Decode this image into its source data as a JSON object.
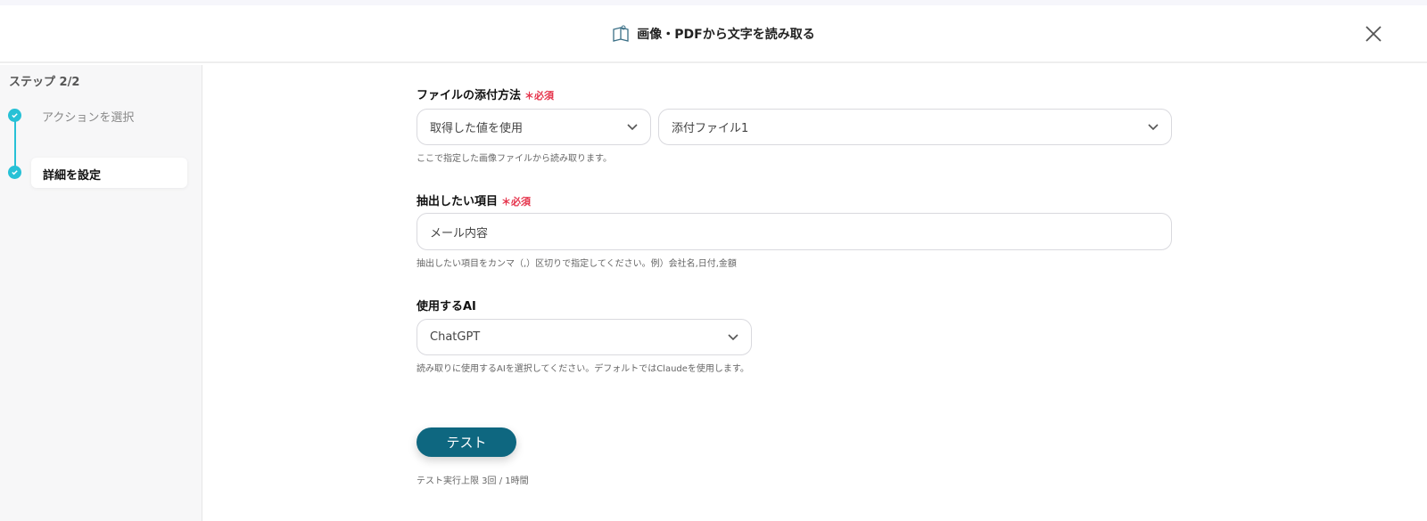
{
  "header": {
    "title": "画像・PDFから文字を読み取る",
    "icon": "book-icon",
    "close_icon": "close-icon"
  },
  "sidebar": {
    "step_count": "ステップ 2/2",
    "steps": [
      {
        "label": "アクションを選択",
        "done": true
      },
      {
        "label": "詳細を設定",
        "done": true,
        "active": true
      }
    ]
  },
  "form": {
    "attach": {
      "label": "ファイルの添付方法",
      "required": "＊必須",
      "method_value": "取得した値を使用",
      "file_value": "添付ファイル1",
      "hint": "ここで指定した画像ファイルから読み取ります。"
    },
    "extract": {
      "label": "抽出したい項目",
      "required": "＊必須",
      "value": "メール内容",
      "hint": "抽出したい項目をカンマ（,）区切りで指定してください。例）会社名,日付,金額"
    },
    "ai": {
      "label": "使用するAI",
      "value": "ChatGPT",
      "hint": "読み取りに使用するAIを選択してください。デフォルトではClaudeを使用します。"
    },
    "test_button": "テスト",
    "test_limit": "テスト実行上限 3回 / 1時間"
  },
  "colors": {
    "accent": "#27c1d6",
    "button": "#0e6780",
    "required": "#e5334b"
  }
}
